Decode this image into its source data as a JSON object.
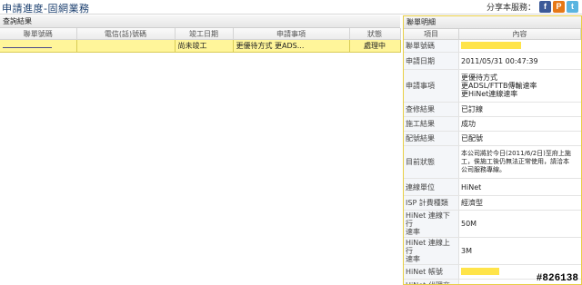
{
  "page": {
    "title": "申請進度-固網業務",
    "share_label": "分享本服務：",
    "share_icons": [
      {
        "name": "facebook-icon",
        "glyph": "f",
        "color": "#3b5998"
      },
      {
        "name": "plurk-icon",
        "glyph": "P",
        "color": "#e67817"
      },
      {
        "name": "twitter-icon",
        "glyph": "t",
        "color": "#5ab4e0"
      }
    ]
  },
  "results": {
    "title": "查詢結果",
    "columns": [
      "聯單號碼",
      "電信(話)號碼",
      "竣工日期",
      "申請事項",
      "狀態"
    ],
    "row": {
      "col0": "",
      "col1": "",
      "col2": "尚未竣工",
      "col3": "更優待方式 更ADS...",
      "col4": "處理中"
    }
  },
  "detail": {
    "title": "聯單明細",
    "col_item": "項目",
    "col_content": "內容",
    "rows": [
      {
        "key": "聯單號碼",
        "value": ""
      },
      {
        "key": "申請日期",
        "value": "2011/05/31 00:47:39"
      },
      {
        "key": "申請事項",
        "value": "更優待方式\n更ADSL/FTTB傳輸速率\n更HiNet連線速率"
      },
      {
        "key": "查修結果",
        "value": "已訂線"
      },
      {
        "key": "施工結果",
        "value": "成功"
      },
      {
        "key": "配號結果",
        "value": "已配號"
      },
      {
        "key": "目前狀態",
        "value": "本公司將於今日(2011/6/2日)至府上施\n工，俟施工後仍無法正常使用，請洽本\n公司服務專線。"
      },
      {
        "key": "連線單位",
        "value": "HiNet"
      },
      {
        "key": "ISP 計費種類",
        "value": "經濟型"
      },
      {
        "key": "HiNet 連線下行\n速率",
        "value": "50M"
      },
      {
        "key": "HiNet 連線上行\n速率",
        "value": "3M"
      },
      {
        "key": "HiNet 帳號",
        "value": ""
      },
      {
        "key": "HiNet 代理商",
        "value": ""
      }
    ]
  },
  "watermark": "#826138",
  "colors": {
    "selected_row": "#fff59a",
    "redaction": "#ffe44a",
    "detail_border": "#e8cf45",
    "title_text": "#1a3e6e"
  }
}
